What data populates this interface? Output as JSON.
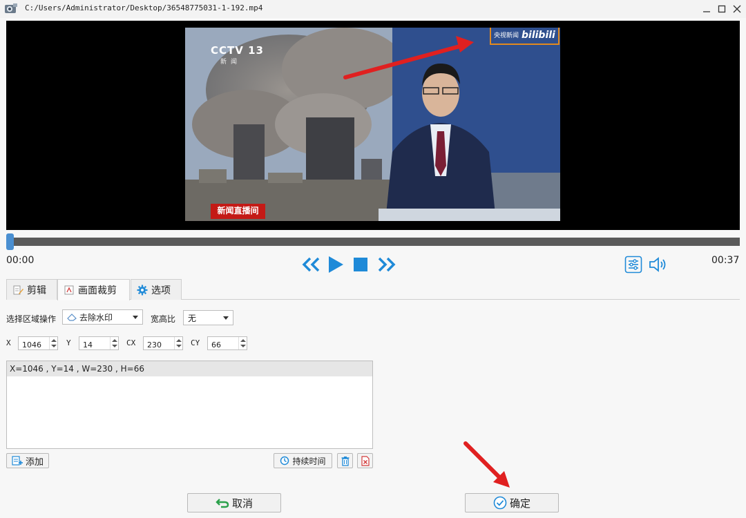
{
  "window": {
    "title": "C:/Users/Administrator/Desktop/36548775031-1-192.mp4"
  },
  "video": {
    "channel_logo": "CCTV 13",
    "channel_sub": "新闻",
    "watermark_text": "央视新闻",
    "watermark_brand": "bilibili",
    "news_tag": "新闻直播间"
  },
  "player": {
    "progress": 0.0,
    "time_current": "00:00",
    "time_total": "00:37"
  },
  "tabs": [
    {
      "label": "剪辑",
      "icon": "edit-icon"
    },
    {
      "label": "画面裁剪",
      "icon": "crop-icon"
    },
    {
      "label": "选项",
      "icon": "gear-icon"
    }
  ],
  "form": {
    "region_op_label": "选择区域操作",
    "region_op_value": "去除水印",
    "aspect_label": "宽高比",
    "aspect_value": "无",
    "x_label": "X",
    "x_value": "1046",
    "y_label": "Y",
    "y_value": "14",
    "cx_label": "CX",
    "cx_value": "230",
    "cy_label": "CY",
    "cy_value": "66"
  },
  "regions": [
    "X=1046 , Y=14 , W=230 , H=66"
  ],
  "buttons": {
    "add": "添加",
    "duration": "持续时间",
    "cancel": "取消",
    "ok": "确定"
  },
  "colors": {
    "accent": "#1f8ad8",
    "highlight_box": "#e38a1e",
    "arrow_red": "#e02020"
  }
}
